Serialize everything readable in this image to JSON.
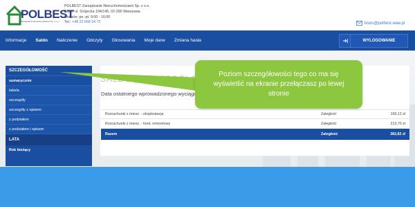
{
  "logo": {
    "text": "POLBEST",
    "subtitle": "Zarządzanie Nieruchomościami Sp. z o.o."
  },
  "company": {
    "name": "POLBEST Zarządzanie Nieruchomościami Sp. z o.o.",
    "address": "Biuro: ul. Grójecka 194/145, 02-390 Warszawa",
    "hours": "Otwarte: pn.-pt. 9:00 - 16:00",
    "tel_label": "Tel.:",
    "tel_value": "+48 22 668 54 72"
  },
  "email": "biuro@polbest.waw.pl",
  "nav": {
    "items": [
      {
        "label": "Informacje",
        "active": false
      },
      {
        "label": "Saldo",
        "active": true
      },
      {
        "label": "Naliczenie",
        "active": false
      },
      {
        "label": "Odczyty",
        "active": false
      },
      {
        "label": "Głosowania",
        "active": false
      },
      {
        "label": "Moje dane",
        "active": false
      },
      {
        "label": "Zmiana hasła",
        "active": false
      }
    ],
    "logout": "WYLOGOWANIE"
  },
  "sidebar": {
    "header": "SZCZEGÓŁOWOŚĆ",
    "items": [
      "sumarycznie",
      "tabela",
      "szczegóły",
      "szczegóły z opisem",
      "z podziałem",
      "z podziałem i opisem"
    ],
    "section2_header": "LATA",
    "section2_items": [
      "Rok bieżący"
    ]
  },
  "main": {
    "title": "SALDO | SZCZEGÓŁOWY",
    "subtitle": "Data ostatniego wprowadzonego wyciągu"
  },
  "table": {
    "rows": [
      {
        "name": "Rozrachunki z miesz. - eksploatacja",
        "status": "Zaległość",
        "amount": "169,12 zł"
      },
      {
        "name": "Rozrachunki z miesz. - fund. remontowy",
        "status": "Zaległość",
        "amount": "213,70 zł"
      }
    ],
    "total": {
      "name": "Razem",
      "status": "Zaległość",
      "amount": "382,82 zł"
    }
  },
  "tooltip": "Poziom szczegółowości tego co ma się wyświetlić na ekranie przełączasz po lewej stronie",
  "colors": {
    "brand": "#1a4ea0",
    "accent": "#3c9be8",
    "tooltip": "#8dc63f"
  }
}
